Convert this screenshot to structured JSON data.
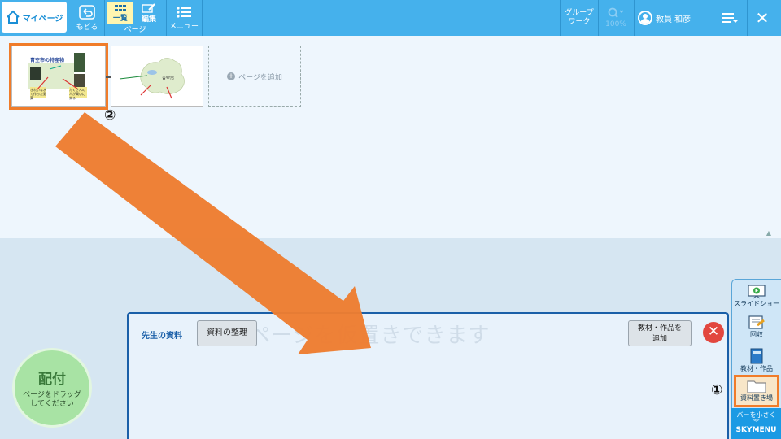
{
  "topbar": {
    "mypage_label": "マイページ",
    "back_label": "もどる",
    "list_label": "一覧",
    "edit_label": "編集",
    "page_label": "ページ",
    "menu_label": "メニュー",
    "group_line1": "グループ",
    "group_line2": "ワーク",
    "zoom_label": "100%",
    "user_name": "教員 和彦",
    "close_label": "✕"
  },
  "thumb1": {
    "title": "青空市の特産物",
    "caption_a": "きれいな水で作った野菜",
    "caption_b": "たくさんの人が買いに来る"
  },
  "thumb2": {
    "label": "青空市"
  },
  "add_page_label": "ページを追加",
  "marker_1": "①",
  "marker_2": "②",
  "tray": {
    "title": "先生の資料",
    "organize_button": "資料の整理",
    "add_button_line1": "教材・作品を",
    "add_button_line2": "追加",
    "drop_hint": "ページを仮置きできます",
    "close_label": "✕"
  },
  "distribute": {
    "title": "配付",
    "sub_line1": "ページをドラッグ",
    "sub_line2": "してください"
  },
  "sidebar": {
    "slideshow": "スライドショー",
    "collect": "回収",
    "materials": "教材・作品",
    "storage": "資料置き場",
    "shrink": "バーを小さく",
    "brand": "SKYMENU"
  },
  "colors": {
    "accent": "#45b1ec",
    "highlight": "#f07c2a",
    "tray_border": "#1a5fa8"
  }
}
